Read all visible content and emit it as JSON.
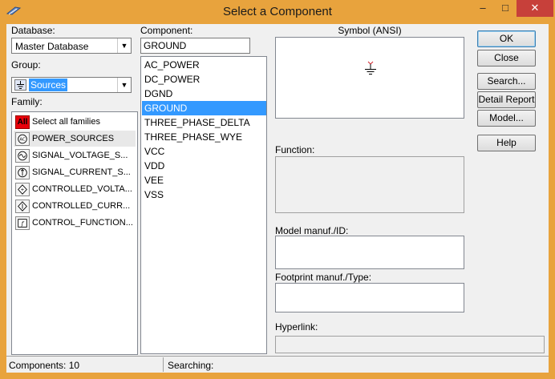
{
  "window": {
    "title": "Select a Component",
    "close_glyph": "✕",
    "minimize_glyph": "–",
    "maximize_glyph": "□"
  },
  "database": {
    "label": "Database:",
    "value": "Master Database"
  },
  "group": {
    "label": "Group:",
    "value": "Sources"
  },
  "family": {
    "label": "Family:",
    "select_all_badge": "All",
    "items": [
      {
        "label": "Select all families",
        "icon": "all-icon"
      },
      {
        "label": "POWER_SOURCES",
        "icon": "power-source-icon"
      },
      {
        "label": "SIGNAL_VOLTAGE_S...",
        "icon": "signal-voltage-icon"
      },
      {
        "label": "SIGNAL_CURRENT_S...",
        "icon": "signal-current-icon"
      },
      {
        "label": "CONTROLLED_VOLTA...",
        "icon": "controlled-voltage-icon"
      },
      {
        "label": "CONTROLLED_CURR...",
        "icon": "controlled-current-icon"
      },
      {
        "label": "CONTROL_FUNCTION...",
        "icon": "control-function-icon"
      }
    ],
    "selected_index": 1
  },
  "component": {
    "label": "Component:",
    "search_value": "GROUND",
    "items": [
      "AC_POWER",
      "DC_POWER",
      "DGND",
      "GROUND",
      "THREE_PHASE_DELTA",
      "THREE_PHASE_WYE",
      "VCC",
      "VDD",
      "VEE",
      "VSS"
    ],
    "selected_index": 3
  },
  "symbol": {
    "label": "Symbol (ANSI)"
  },
  "function": {
    "label": "Function:"
  },
  "model_manuf": {
    "label": "Model manuf./ID:"
  },
  "footprint": {
    "label": "Footprint manuf./Type:"
  },
  "hyperlink": {
    "label": "Hyperlink:"
  },
  "buttons": {
    "ok": "OK",
    "close": "Close",
    "search": "Search...",
    "detail_report": "Detail Report",
    "model": "Model...",
    "help": "Help"
  },
  "status": {
    "components": "Components: 10",
    "searching": "Searching:"
  },
  "colors": {
    "titlebar": "#e8a33d",
    "selection": "#3399ff",
    "close_button": "#c7403a",
    "all_badge": "#e8000b"
  }
}
